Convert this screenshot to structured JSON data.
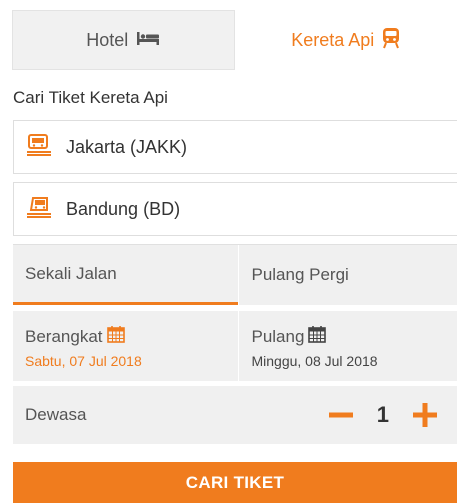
{
  "tabs": {
    "hotel_label": "Hotel",
    "train_label": "Kereta Api",
    "active": "Kereta Api"
  },
  "subtitle": "Cari Tiket Kereta Api",
  "origin": {
    "value": "Jakarta (JAKK)",
    "icon": "train-departure-icon"
  },
  "destination": {
    "value": "Bandung (BD)",
    "icon": "train-arrival-icon"
  },
  "trip_type": {
    "one_way": "Sekali Jalan",
    "round_trip": "Pulang Pergi",
    "selected": "Sekali Jalan"
  },
  "departure": {
    "label": "Berangkat",
    "date": "Sabtu, 07 Jul 2018"
  },
  "return": {
    "label": "Pulang",
    "date": "Minggu, 08 Jul 2018"
  },
  "passengers": {
    "label": "Dewasa",
    "count": "1"
  },
  "search_button": "CARI TIKET",
  "colors": {
    "accent": "#f07c1e",
    "panel": "#f0f0f0"
  }
}
